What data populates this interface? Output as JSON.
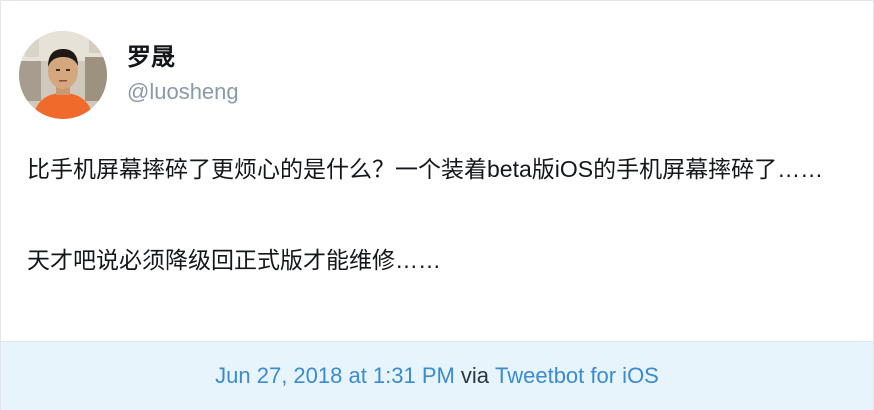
{
  "author": {
    "display_name": "罗晟",
    "handle": "@luosheng"
  },
  "tweet": {
    "paragraph_1": "比手机屏幕摔碎了更烦心的是什么？一个装着beta版iOS的手机屏幕摔碎了……",
    "paragraph_2": "天才吧说必须降级回正式版才能维修……"
  },
  "footer": {
    "timestamp": "Jun 27, 2018 at 1:31 PM",
    "via": "via",
    "client": "Tweetbot for iOS"
  },
  "colors": {
    "link": "#3a8bd0",
    "footer_bg": "#e8f4fc",
    "handle": "#8a9aa8",
    "text": "#14171a",
    "avatar_shirt": "#f06a2c"
  }
}
